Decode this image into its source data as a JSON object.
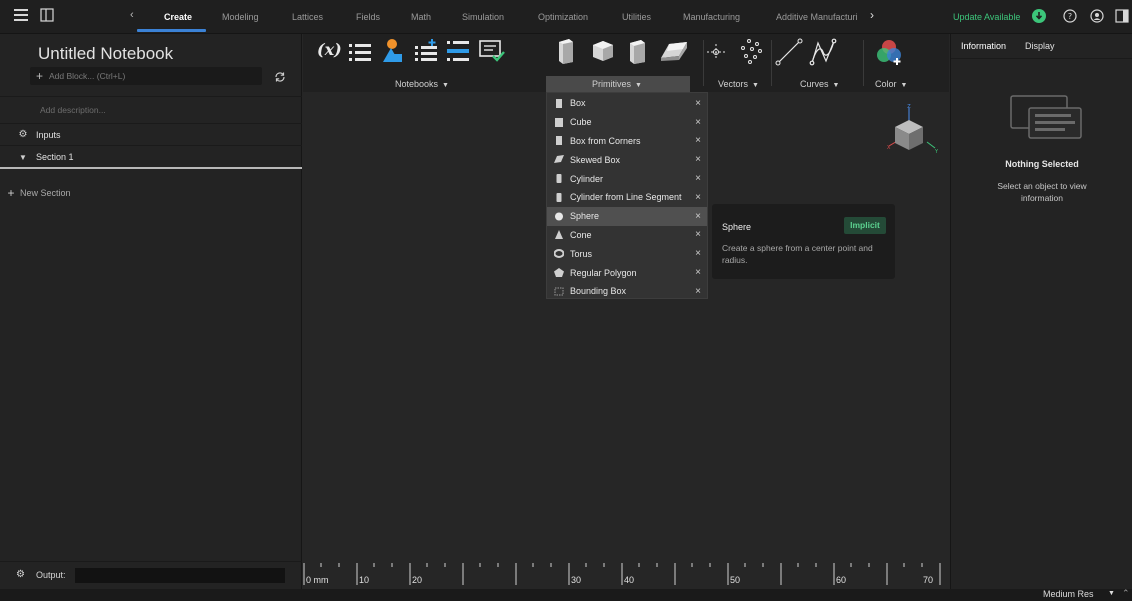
{
  "tabs": [
    "Create",
    "Modeling",
    "Lattices",
    "Fields",
    "Math",
    "Simulation",
    "Optimization",
    "Utilities",
    "Manufacturing",
    "Additive Manufacturi"
  ],
  "active_tab": "Create",
  "update_label": "Update Available",
  "notebook": {
    "title": "Untitled Notebook",
    "add_block_placeholder": "Add Block... (Ctrl+L)",
    "description_placeholder": "Add description...",
    "inputs_label": "Inputs",
    "section_label": "Section 1",
    "new_section_label": "New Section",
    "output_label": "Output:"
  },
  "ribbon": {
    "groups": [
      "Notebooks",
      "Primitives",
      "Vectors",
      "Curves",
      "Color"
    ],
    "active_group": "Primitives"
  },
  "primitives_menu": {
    "items": [
      "Box",
      "Cube",
      "Box from Corners",
      "Skewed Box",
      "Cylinder",
      "Cylinder from Line Segment",
      "Sphere",
      "Cone",
      "Torus",
      "Regular Polygon",
      "Bounding Box"
    ],
    "highlighted": "Sphere",
    "remove_symbol": "×"
  },
  "tooltip": {
    "title": "Sphere",
    "badge": "Implicit",
    "description": "Create a sphere from a center point and radius."
  },
  "ruler": {
    "unit": "mm",
    "labels": [
      "0",
      "10",
      "20",
      "30",
      "40",
      "50",
      "60",
      "70"
    ]
  },
  "right_panel": {
    "tabs": [
      "Information",
      "Display"
    ],
    "nothing_selected": "Nothing Selected",
    "select_message": "Select an object to view information"
  },
  "status": {
    "resolution": "Medium Res"
  },
  "colors": {
    "accent": "#3b82d6",
    "update_green": "#3cc57a",
    "badge_green": "#5bd08f"
  }
}
